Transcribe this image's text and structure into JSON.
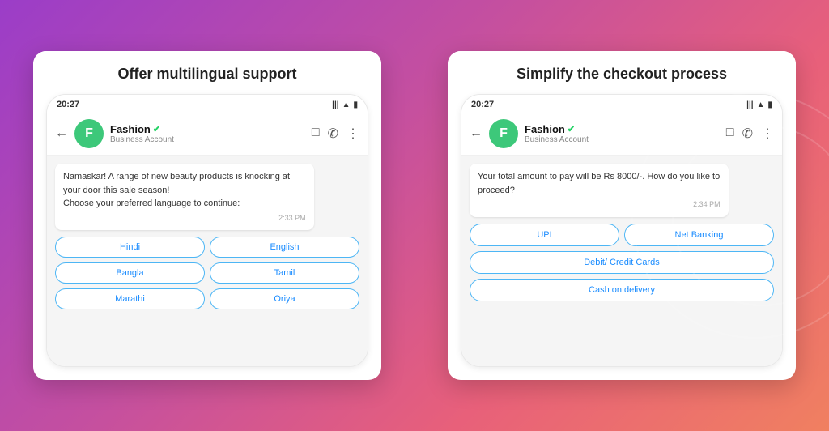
{
  "left_panel": {
    "title": "Offer multilingual support",
    "status_time": "20:27",
    "contact_name": "Fashion",
    "contact_sub": "Business Account",
    "message_text": "Namaskar! A range of new beauty products is knocking at your door this sale season!\nChoose your preferred language to continue:",
    "message_time": "2:33 PM",
    "languages": [
      "Hindi",
      "English",
      "Bangla",
      "Tamil",
      "Marathi",
      "Oriya"
    ]
  },
  "right_panel": {
    "title": "Simplify the checkout process",
    "status_time": "20:27",
    "contact_name": "Fashion",
    "contact_sub": "Business Account",
    "message_text": "Your total amount to pay will be Rs 8000/-. How do you like to proceed?",
    "message_time": "2:34 PM",
    "payment_options": {
      "row1": [
        "UPI",
        "Net Banking"
      ],
      "row2": [
        "Debit/ Credit Cards"
      ],
      "row3": [
        "Cash on delivery"
      ]
    }
  },
  "icons": {
    "back": "←",
    "avatar_left": "F",
    "avatar_right": "F",
    "verified": "✔",
    "video": "□",
    "call": "✆",
    "more": "⋮",
    "signal_bars": "|||",
    "wifi": "▲",
    "battery": "▮"
  }
}
